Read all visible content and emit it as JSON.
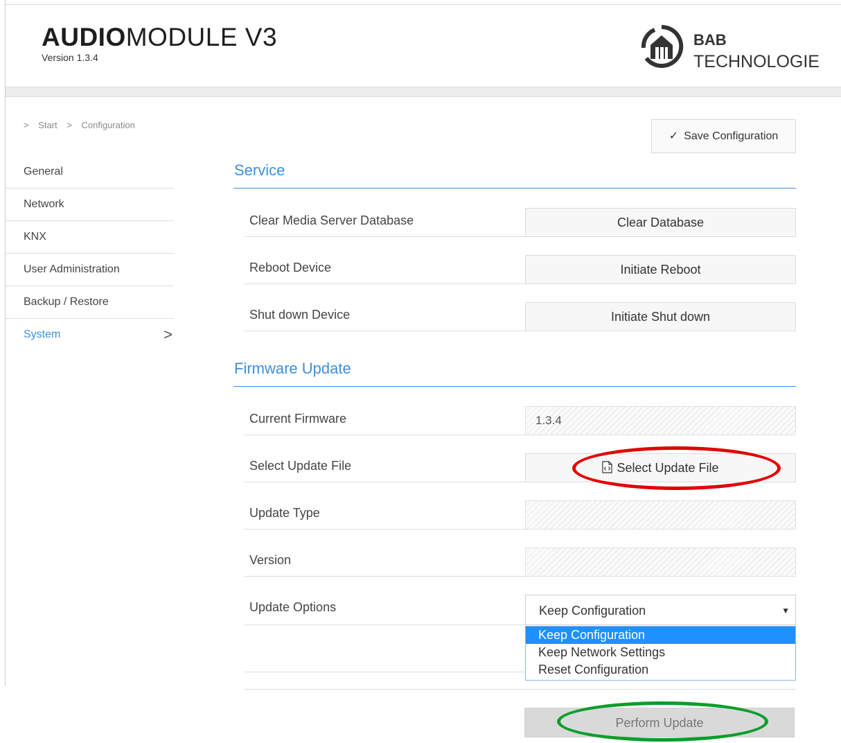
{
  "header": {
    "title_bold": "AUDIO",
    "title_light": "MODULE V3",
    "version": "Version 1.3.4",
    "brand_line1": "BAB",
    "brand_line2": "TECHNOLOGIE"
  },
  "breadcrumb": [
    ">",
    "Start",
    ">",
    "Configuration"
  ],
  "sidebar": {
    "items": [
      {
        "label": "General"
      },
      {
        "label": "Network"
      },
      {
        "label": "KNX"
      },
      {
        "label": "User Administration"
      },
      {
        "label": "Backup / Restore"
      },
      {
        "label": "System",
        "active": true
      }
    ],
    "active_chevron": ">"
  },
  "toolbar": {
    "save_check": "✓",
    "save_label": "Save Configuration"
  },
  "service": {
    "title": "Service",
    "rows": [
      {
        "label": "Clear Media Server Database",
        "button": "Clear Database"
      },
      {
        "label": "Reboot Device",
        "button": "Initiate Reboot"
      },
      {
        "label": "Shut down Device",
        "button": "Initiate Shut down"
      }
    ]
  },
  "firmware": {
    "title": "Firmware Update",
    "current_label": "Current Firmware",
    "current_value": "1.3.4",
    "select_label": "Select Update File",
    "select_button": "Select Update File",
    "type_label": "Update Type",
    "type_value": "",
    "version_label": "Version",
    "version_value": "",
    "options_label": "Update Options",
    "options_selected": "Keep Configuration",
    "options_arrow": "▼",
    "options": [
      "Keep Configuration",
      "Keep Network Settings",
      "Reset Configuration"
    ],
    "perform_button": "Perform Update"
  },
  "colors": {
    "accent": "#3d8fd8",
    "highlight_red": "#e30000",
    "highlight_green": "#0a9e2a",
    "option_selected": "#1e90ff"
  }
}
